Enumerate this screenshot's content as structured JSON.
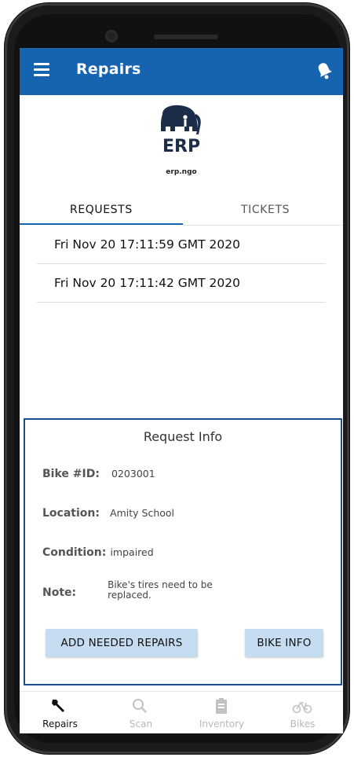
{
  "app": {
    "title": "Repairs"
  },
  "logo": {
    "brand": "ERP",
    "url": "erp.ngo"
  },
  "tabs": [
    {
      "label": "REQUESTS",
      "active": true
    },
    {
      "label": "TICKETS",
      "active": false
    }
  ],
  "requests": [
    {
      "label": "Fri Nov 20 17:11:59 GMT 2020"
    },
    {
      "label": "Fri Nov 20 17:11:42 GMT 2020"
    }
  ],
  "request_info": {
    "title": "Request Info",
    "bike_id_label": "Bike #ID:",
    "bike_id_value": "0203001",
    "location_label": "Location:",
    "location_value": "Amity School",
    "condition_label": "Condition:",
    "condition_value": "impaired",
    "note_label": "Note:",
    "note_value": "Bike's tires need to be replaced.",
    "add_repairs_button": "ADD NEEDED REPAIRS",
    "bike_info_button": "BIKE INFO"
  },
  "bottom_nav": [
    {
      "label": "Repairs",
      "icon": "wrench-icon",
      "active": true
    },
    {
      "label": "Scan",
      "icon": "magnifier-icon",
      "active": false
    },
    {
      "label": "Inventory",
      "icon": "clipboard-icon",
      "active": false
    },
    {
      "label": "Bikes",
      "icon": "bicycle-icon",
      "active": false
    }
  ],
  "colors": {
    "appbar": "#1664b0",
    "accent": "#1664b0",
    "panel_border": "#1a4d8f",
    "button_bg": "#c6dcf0"
  }
}
